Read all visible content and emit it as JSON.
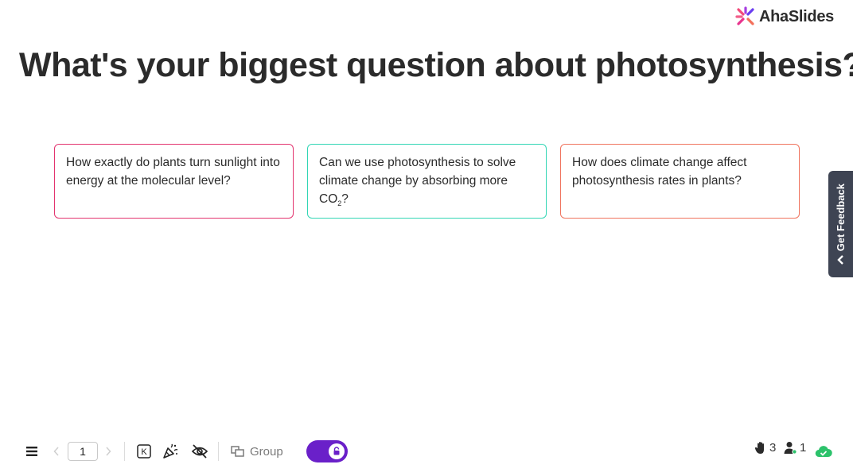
{
  "brand": {
    "name": "AhaSlides"
  },
  "slide": {
    "title": "What's your biggest question about photosynthesis?",
    "responses": [
      {
        "text": "How exactly do plants turn sunlight into energy at the molecular level?",
        "color": "#e3346f"
      },
      {
        "text_before": "Can we use photosynthesis to solve climate change by absorbing more CO",
        "subscript": "2",
        "text_after": "?",
        "color": "#32d6b5"
      },
      {
        "text": "How does climate change affect photosynthesis rates in plants?",
        "color": "#f0745e"
      }
    ]
  },
  "feedback_tab": {
    "label": "Get Feedback"
  },
  "toolbar": {
    "page_number": "1",
    "shortcut_key": "K",
    "group_label": "Group",
    "raised_hands": "3",
    "participants": "1",
    "toggle_on": true
  },
  "colors": {
    "accent": "#6a20c9",
    "cloud_ok": "#2cc26b"
  },
  "icons": [
    "menu-icon",
    "chevron-left-icon",
    "chevron-right-icon",
    "keyboard-shortcut-icon",
    "confetti-icon",
    "eye-off-icon",
    "group-icon",
    "lock-icon",
    "hand-icon",
    "person-icon",
    "cloud-check-icon"
  ]
}
